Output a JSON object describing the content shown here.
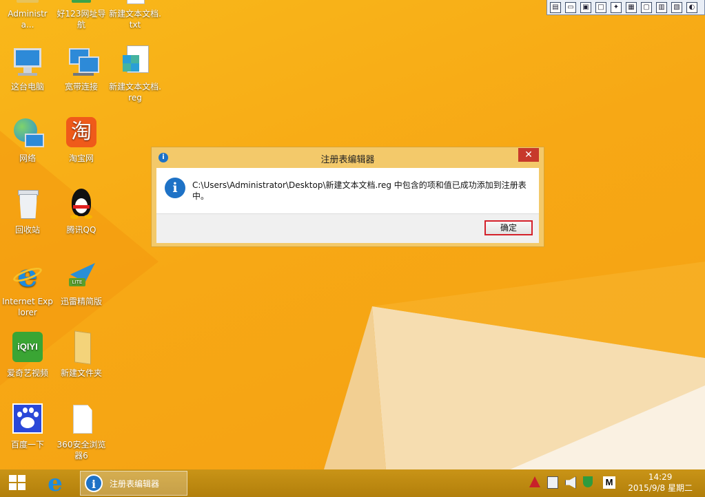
{
  "desktop": {
    "icons": [
      {
        "label": "Administra..."
      },
      {
        "label": "好123网址导航"
      },
      {
        "label": "新建文本文档.txt"
      },
      {
        "label": "这台电脑"
      },
      {
        "label": "宽带连接"
      },
      {
        "label": "新建文本文档.reg"
      },
      {
        "label": "网络"
      },
      {
        "label": "淘宝网"
      },
      {
        "label": "回收站"
      },
      {
        "label": "腾讯QQ"
      },
      {
        "label": "Internet Explorer"
      },
      {
        "label": "迅雷精简版"
      },
      {
        "label": "爱奇艺视频"
      },
      {
        "label": "新建文件夹"
      },
      {
        "label": "百度一下"
      },
      {
        "label": "360安全浏览器6"
      }
    ],
    "icon_glyphs": {
      "taobao": "淘",
      "ie": "e",
      "iqiyi": "iQIYI",
      "lite": "LITE"
    }
  },
  "dialog": {
    "title": "注册表编辑器",
    "close_glyph": "✕",
    "info_glyph": "i",
    "message": "C:\\Users\\Administrator\\Desktop\\新建文本文档.reg 中包含的项和值已成功添加到注册表中。",
    "ok_label": "确定"
  },
  "taskbar": {
    "app_label": "注册表编辑器",
    "ime_label": "M",
    "time": "14:29",
    "date": "2015/9/8 星期二"
  },
  "colors": {
    "wallpaper": "#f7a815",
    "taskbar": "#b9860f",
    "info_blue": "#1e72c6",
    "close_red": "#c7392b",
    "focus_red": "#d4202a"
  }
}
